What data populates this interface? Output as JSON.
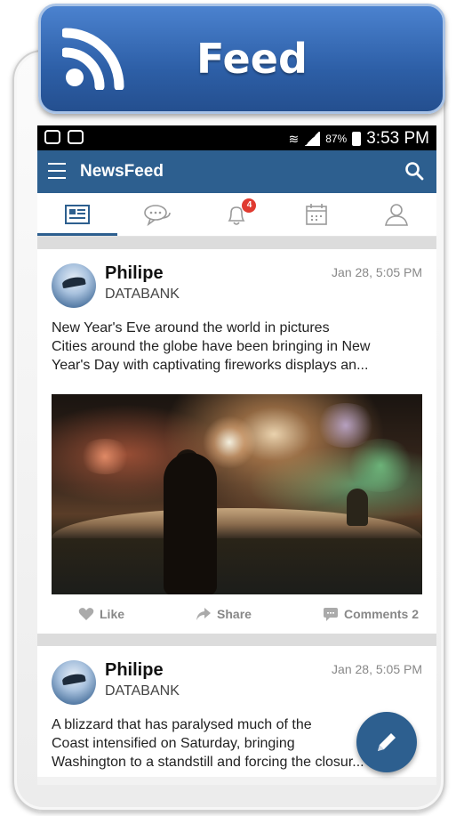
{
  "header": {
    "title": "Feed",
    "icon": "rss-icon",
    "color": "#2d5fa7"
  },
  "statusbar": {
    "battery": "87%",
    "time": "3:53 PM"
  },
  "appbar": {
    "title": "NewsFeed",
    "color": "#2d5f8f"
  },
  "tabs": [
    {
      "name": "news-tab",
      "icon": "news-icon",
      "active": true
    },
    {
      "name": "chat-tab",
      "icon": "chat-icon"
    },
    {
      "name": "notifications-tab",
      "icon": "bell-icon",
      "badge": "4"
    },
    {
      "name": "calendar-tab",
      "icon": "calendar-icon"
    },
    {
      "name": "profile-tab",
      "icon": "person-icon"
    }
  ],
  "posts": [
    {
      "author": "Philipe",
      "source": "DATABANK",
      "time": "Jan 28, 5:05 PM",
      "lines": [
        "New Year's Eve around the world in pictures",
        "Cities around the globe have been bringing in New",
        "Year's Day with captivating fireworks displays an..."
      ],
      "actions": {
        "like": "Like",
        "share": "Share",
        "comments": "Comments 2"
      }
    },
    {
      "author": "Philipe",
      "source": "DATABANK",
      "time": "Jan 28, 5:05 PM",
      "lines": [
        "A blizzard that has paralysed much of the",
        "Coast intensified on Saturday, bringing",
        "Washington to a standstill and forcing the closur..."
      ]
    }
  ]
}
